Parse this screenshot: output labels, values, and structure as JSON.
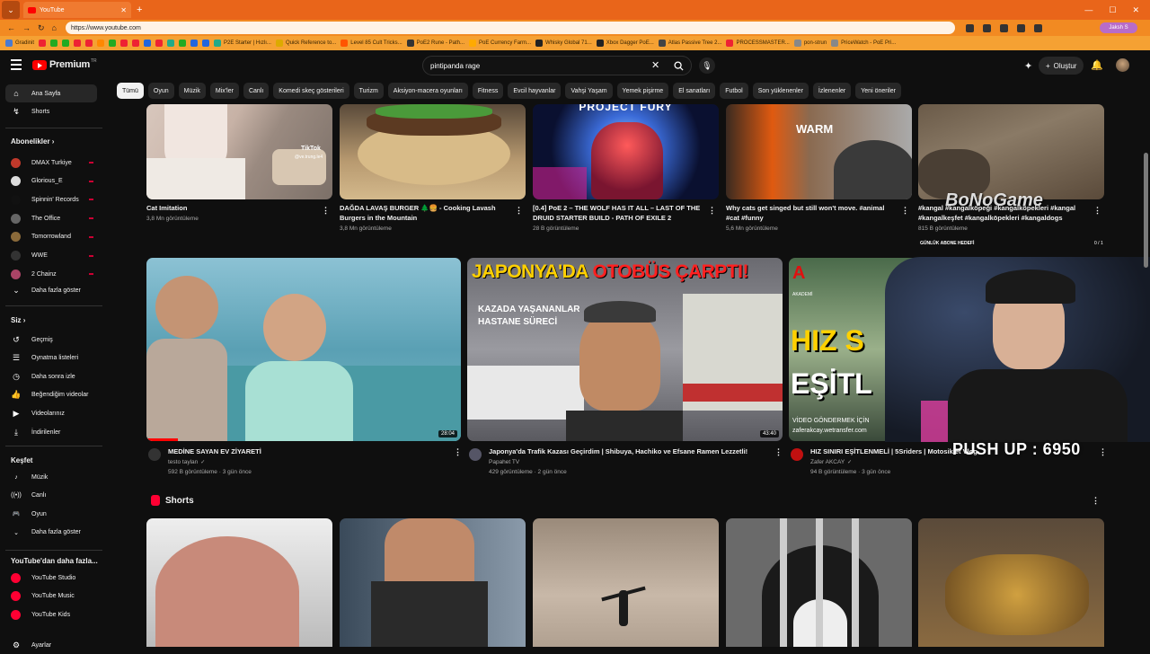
{
  "browser": {
    "tab_title": "YouTube",
    "url": "https://www.youtube.com",
    "profile_label": "Jaksh S",
    "bookmarks": [
      "Gradinit",
      "",
      "",
      "",
      "",
      "",
      "",
      "",
      "",
      "",
      "",
      "",
      "",
      "",
      "",
      "",
      "P2E Starter | Hızlı...",
      "Quick Reference to...",
      "Level 85 Cult Tricks...",
      "PoE2 Rune - Path...",
      "PoE Currency Farm...",
      "Whisky Global 71...",
      "Xbox Dagger PoE...",
      "Atlas Passive Tree 2...",
      "PROCESSMASTER...",
      "pon-strun",
      "PriceWatch - PoE Pri..."
    ],
    "bookmark_colors": [
      "#4a7bd0",
      "#e23",
      "#2a2",
      "#2a2",
      "#e23",
      "#e23",
      "#ff8800",
      "#2a2",
      "#e23",
      "#e23",
      "#2266dd",
      "#e23",
      "#2a8",
      "#2a2",
      "#2266dd",
      "#2266dd",
      "#2a8",
      "#ddaa00",
      "#ff5500",
      "#333",
      "#ffaa00",
      "#222",
      "#222",
      "#444",
      "#e23",
      "#888",
      "#888"
    ]
  },
  "yt": {
    "logo_text": "Premium",
    "logo_sup": "TR",
    "search_value": "pintipanda rage",
    "create_label": "Oluştur",
    "chips": [
      "Tümü",
      "Oyun",
      "Müzik",
      "Mix'ler",
      "Canlı",
      "Komedi skeç gösterileri",
      "Turizm",
      "Aksiyon-macera oyunları",
      "Fitness",
      "Evcil hayvanlar",
      "Vahşi Yaşam",
      "Yemek pişirme",
      "El sanatları",
      "Futbol",
      "Son yüklenenler",
      "İzlenenler",
      "Yeni öneriler"
    ]
  },
  "sidebar": {
    "home": "Ana Sayfa",
    "shorts": "Shorts",
    "subs_head": "Abonelikler",
    "subs": [
      {
        "name": "DMAX Turkiye",
        "color": "#c0392b"
      },
      {
        "name": "Glorious_E",
        "color": "#ddd"
      },
      {
        "name": "Spinnin' Records",
        "color": "#111"
      },
      {
        "name": "The Office",
        "color": "#666"
      },
      {
        "name": "Tomorrowland",
        "color": "#8a6a3a"
      },
      {
        "name": "WWE",
        "color": "#333"
      },
      {
        "name": "2 Chainz",
        "color": "#aa4466"
      }
    ],
    "subs_more": "Daha fazla göster",
    "you_head": "Siz",
    "you_items": [
      "Geçmiş",
      "Oynatma listeleri",
      "Daha sonra izle",
      "Beğendiğim videolar",
      "Videolarınız",
      "İndirilenler"
    ],
    "explore_head": "Keşfet",
    "explore_items": [
      "Müzik",
      "Canlı",
      "Oyun",
      "Daha fazla göster"
    ],
    "more_head": "YouTube'dan daha fazla...",
    "more_items": [
      "YouTube Studio",
      "YouTube Music",
      "YouTube Kids"
    ],
    "settings": "Ayarlar"
  },
  "row1": [
    {
      "title": "Cat Imitation",
      "meta": "3,8 Mn görüntüleme"
    },
    {
      "title": "DAĞDA LAVAŞ BURGER 🌲🍔 - Cooking Lavash Burgers in the Mountain",
      "meta": "3,8 Mn görüntüleme"
    },
    {
      "title": "[0.4] PoE 2 – THE WOLF HAS IT ALL – LAST OF THE DRUID STARTER BUILD - PATH OF EXILE 2",
      "meta": "28 B görüntüleme"
    },
    {
      "title": "Why cats get singed but still won't move. #animal #cat #funny",
      "meta": "5,6 Mn görüntüleme"
    },
    {
      "title": "#kangal #kangalköpeği #kangalköpekleri #kangal #kangalkeşfet #kangalköpekleri #kangaldogs",
      "meta": "815 B görüntüleme"
    }
  ],
  "row1_overlay": {
    "thumb3_text": "PROJECT FURY",
    "thumb4_text": "WARM",
    "tiktok": "TikTok",
    "tiktok_user": "@ve.trung.le4"
  },
  "row2": [
    {
      "title": "MEDİNE SAYAN EV ZİYARETİ",
      "channel": "testo taylan",
      "meta": "592 B görüntüleme · 3 gün önce",
      "duration": "28:04",
      "verified": "✓"
    },
    {
      "title": "Japonya'da Trafik Kazası Geçirdim | Shibuya, Hachiko ve Efsane Ramen Lezzetli!",
      "channel": "Papahet TV",
      "meta": "429 görüntüleme · 2 gün önce",
      "duration": "43:40"
    },
    {
      "title": "HIZ SINIRI EŞİTLENMELİ | 5Sriders | Motosiklet Vlog",
      "channel": "Zafer AKCAY",
      "meta": "94 B görüntüleme · 3 gün önce",
      "verified": "✓"
    }
  ],
  "thumb2_text": {
    "line1a": "JAPONYA'DA",
    "line1b": "OTOBÜS ÇARPTI!",
    "line2": "KAZADA YAŞANANLAR",
    "line3": "HASTANE SÜRECİ"
  },
  "thumb3b_text": {
    "brand": "AKADEMİ",
    "l1": "HIZ S",
    "l2": "EŞİTL",
    "footer": "VİDEO GÖNDERMEK İÇİN",
    "url": "zaferakcay.wetransfer.com"
  },
  "shorts_head": "Shorts",
  "overlay": {
    "watermark": "BoNoGame",
    "sub_goal": "GÜNLÜK ABONE HEDEFİ",
    "sub_goal_count": "0 / 1",
    "pushup": "PUSH UP : 6950"
  }
}
